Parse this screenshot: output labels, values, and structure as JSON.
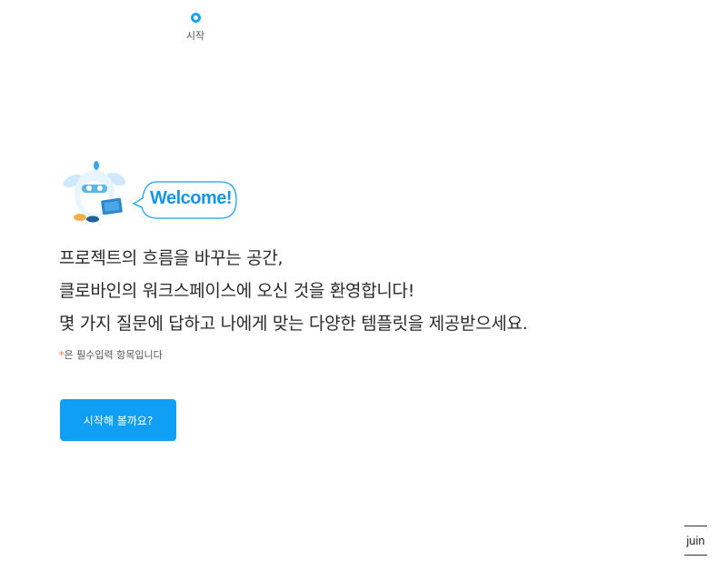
{
  "steps": [
    {
      "label": "시작",
      "active": true
    }
  ],
  "welcome": {
    "bubble_text": "Welcome!",
    "mascot_icon": "bird-mascot-icon"
  },
  "intro": {
    "lines": [
      "프로젝트의 흐름을 바꾸는 공간,",
      "클로바인의 워크스페이스에 오신 것을 환영합니다!",
      "몇 가지 질문에 답하고 나에게 맞는 다양한 템플릿을 제공받으세요."
    ]
  },
  "required_note": {
    "star": "*",
    "text": "은 필수입력 항목입니다"
  },
  "start_button": {
    "label": "시작해 볼까요?"
  },
  "brand": {
    "text": "juin"
  },
  "colors": {
    "accent": "#0fa0f5",
    "step_ring": "#1aa3f0",
    "bubble_text": "#1696e6",
    "required_star": "#f26b3a"
  }
}
